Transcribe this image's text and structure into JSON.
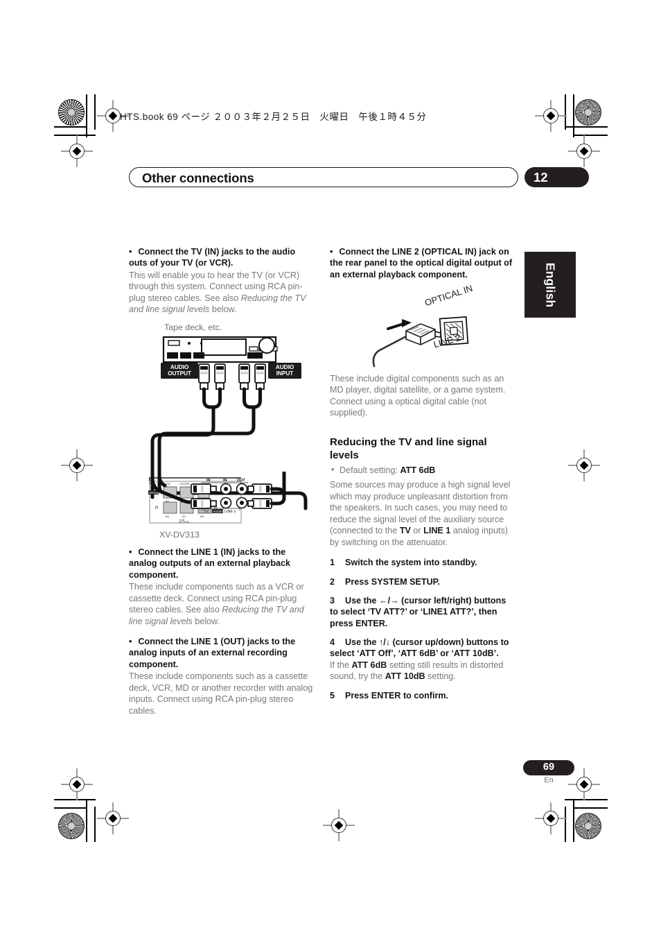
{
  "print_header": {
    "text": "HTS.book  69 ページ  ２００３年２月２５日　火曜日　午後１時４５分"
  },
  "chapter": {
    "title": "Other connections",
    "number": "12"
  },
  "language_tab": {
    "label": "English"
  },
  "footer": {
    "page_number": "69",
    "language_code": "En"
  },
  "left_column": {
    "block1": {
      "bullet": "•",
      "heading": "Connect the TV (IN) jacks to the audio outs of your TV (or VCR).",
      "body_1": "This will enable you to hear the TV (or VCR) through this system. Connect using RCA pin-plug stereo cables. See also ",
      "body_italic": "Reducing the TV and line signal levels",
      "body_2": " below."
    },
    "diagram_tape": {
      "caption": "Tape deck, etc.",
      "audio_output_label_1": "AUDIO",
      "audio_output_label_2": "OUTPUT",
      "audio_input_label_1": "AUDIO",
      "audio_input_label_2": "INPUT"
    },
    "diagram_receiver": {
      "caption": "XV-DV313",
      "jack_in_1": "IN",
      "jack_in_2": "IN",
      "jack_out": "OUT",
      "panel_tv": "TV",
      "panel_audio": "AUDIO",
      "panel_line1": "LINE 1",
      "speaker_left": "L",
      "speaker_right": "R",
      "speaker_left_2": "L",
      "speaker_right_2": "R",
      "impedance": "6Ω",
      "sub_label_1": "FRONT",
      "sub_label_2": "CENTER",
      "sub_label_3": "SUB WOOFER",
      "speakers_tag": "SPEAKERS"
    },
    "block2": {
      "bullet": "•",
      "heading": "Connect the LINE 1 (IN) jacks to the analog outputs of an external playback component.",
      "body_1": "These include components such as a VCR or cassette deck. Connect using RCA pin-plug stereo cables. See also ",
      "body_italic": "Reducing the TV and line signal levels",
      "body_2": " below."
    },
    "block3": {
      "bullet": "•",
      "heading": "Connect the LINE 1 (OUT) jacks to the analog inputs of an external recording component.",
      "body_1": "These include components such as a cassette deck, VCR, MD or another recorder with analog inputs. Connect using RCA pin-plug stereo cables."
    }
  },
  "right_column": {
    "block1": {
      "bullet": "•",
      "heading": "Connect the LINE 2 (OPTICAL IN) jack on the rear panel to the optical digital output of an external playback component."
    },
    "diagram_optical": {
      "label_optical_in": "OPTICAL IN",
      "label_line2": "LINE 2"
    },
    "block2": {
      "body_1": "These include digital components such as an MD player, digital satellite, or a game system. Connect using a optical digital cable (not supplied)."
    },
    "subsection": {
      "heading": "Reducing the TV and line signal levels",
      "default_setting_prefix": "Default setting: ",
      "default_setting_value": "ATT 6dB",
      "body_1": "Some sources may produce a high signal level which may produce unpleasant distortion from the speakers. In such cases, you may need to reduce the signal level of the auxiliary source (connected to the ",
      "body_bold_1": "TV",
      "body_2": " or ",
      "body_bold_2": "LINE 1",
      "body_3": " analog inputs) by switching on the attenuator.",
      "steps": [
        {
          "index": "1",
          "text": "Switch the system into standby."
        },
        {
          "index": "2",
          "text": "Press SYSTEM SETUP."
        },
        {
          "index": "3",
          "text": "Use the ←/→ (cursor left/right) buttons to select ‘TV ATT?’ or ‘LINE1 ATT?’, then press ENTER."
        },
        {
          "index": "4",
          "text": "Use the ↑/↓ (cursor up/down) buttons to select ‘ATT Off’, ‘ATT 6dB’ or ‘ATT 10dB’."
        },
        {
          "index": "5",
          "text": "Press ENTER to confirm."
        }
      ],
      "step4_note_1": "If the ",
      "step4_note_bold_1": "ATT 6dB",
      "step4_note_2": " setting still results in distorted sound, try the ",
      "step4_note_bold_2": "ATT 10dB",
      "step4_note_3": " setting."
    }
  },
  "colors": {
    "ink": "#231f20",
    "body_gray": "#787878",
    "accent_dark": "#1c1c1c"
  }
}
